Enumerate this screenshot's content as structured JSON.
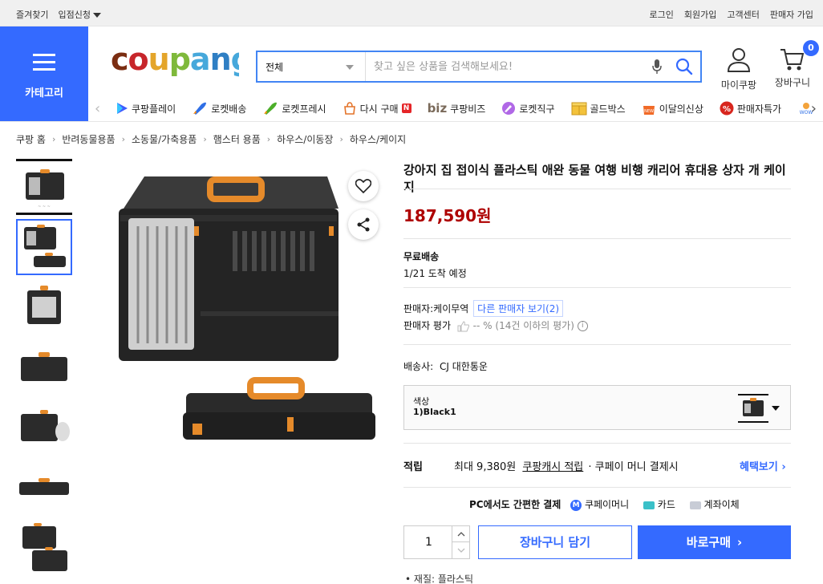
{
  "topbar": {
    "left": [
      "즐겨찾기",
      "입점신청"
    ],
    "right": [
      "로그인",
      "회원가입",
      "고객센터",
      "판매자 가입"
    ]
  },
  "category_label": "카테고리",
  "logo": "coupang",
  "search": {
    "category": "전체",
    "placeholder": "찾고 싶은 상품을 검색해보세요!"
  },
  "header": {
    "mycoupang": "마이쿠팡",
    "cart": "장바구니",
    "cart_count": "0"
  },
  "catnav": [
    {
      "label": "쿠팡플레이",
      "icon": "play-icon"
    },
    {
      "label": "로켓배송",
      "icon": "rocket-icon"
    },
    {
      "label": "로켓프레시",
      "icon": "rocket-fresh-icon"
    },
    {
      "label": "다시 구매",
      "icon": "rebuy-icon"
    },
    {
      "label": "쿠팡비즈",
      "icon": "biz-icon"
    },
    {
      "label": "로켓직구",
      "icon": "global-icon"
    },
    {
      "label": "골드박스",
      "icon": "goldbox-icon"
    },
    {
      "label": "이달의신상",
      "icon": "new-icon"
    },
    {
      "label": "판매자특가",
      "icon": "percent-icon"
    }
  ],
  "breadcrumb": [
    "쿠팡 홈",
    "반려동물용품",
    "소동물/가축용품",
    "햄스터 용품",
    "하우스/이동장",
    "하우스/케이지"
  ],
  "product": {
    "title": "강아지 집 접이식 플라스틱 애완 동물 여행 비행 캐리어 휴대용 상자 개 케이지",
    "price": "187,590원",
    "shipping_label": "무료배송",
    "arrival": "1/21 도착 예정",
    "seller_label": "판매자:",
    "seller": "케이무역",
    "other_seller": "다른 판매자 보기(2)",
    "rating_label": "판매자 평가",
    "rating_value": "-- %",
    "rating_note": "(14건 이하의 평가)",
    "courier_label": "배송사:",
    "courier": "CJ 대한통운",
    "option_key": "색상",
    "option_value": "1)Black1",
    "reward_label": "적립",
    "reward_text": "최대 9,380원",
    "reward_link": "쿠팡캐시 적립",
    "reward_extra": "· 쿠페이 머니 결제시",
    "benefit_link": "혜택보기",
    "pc_pay": "PC에서도 간편한 결제",
    "pay_methods": [
      "쿠페이머니",
      "카드",
      "계좌이체"
    ],
    "quantity": "1",
    "cart_button": "장바구니 담기",
    "buy_button": "바로구매",
    "spec": "재질: 플라스틱"
  },
  "colors": {
    "brand_blue": "#346aff",
    "price_red": "#ae0000"
  }
}
